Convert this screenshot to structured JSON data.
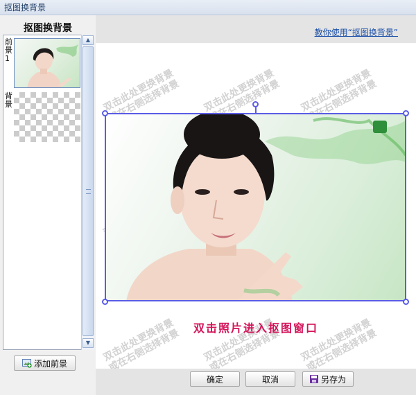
{
  "window": {
    "title": "抠图换背景"
  },
  "sidebar": {
    "title": "抠图换背景",
    "layers": [
      {
        "label": "前景1"
      },
      {
        "label": "背景"
      }
    ],
    "add_foreground_label": "添加前景"
  },
  "main": {
    "help_link": "教你使用“抠图换背景”",
    "watermark": {
      "line1": "双击此处更换背景",
      "line2": "或在右侧选择背景"
    },
    "instruction": "双击照片进入抠图窗口"
  },
  "footer": {
    "ok_label": "确定",
    "cancel_label": "取消",
    "save_as_label": "另存为"
  },
  "colors": {
    "selection": "#5a5ce6",
    "instruction": "#d4145a",
    "link": "#1a4ea8"
  }
}
